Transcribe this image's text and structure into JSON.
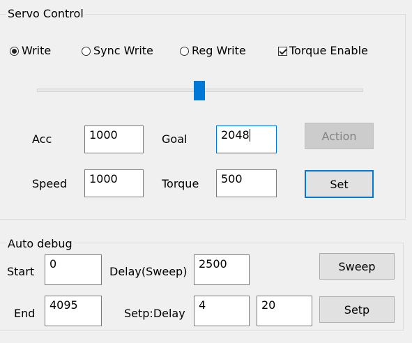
{
  "servo": {
    "title": "Servo Control",
    "modes": [
      {
        "label": "Write",
        "checked": true
      },
      {
        "label": "Sync Write",
        "checked": false
      },
      {
        "label": "Reg Write",
        "checked": false
      }
    ],
    "torque_enable": {
      "label": "Torque Enable",
      "checked": true
    },
    "slider": {
      "value": 0.5
    },
    "acc": {
      "label": "Acc",
      "value": "1000"
    },
    "speed": {
      "label": "Speed",
      "value": "1000"
    },
    "goal": {
      "label": "Goal",
      "value": "2048"
    },
    "torque": {
      "label": "Torque",
      "value": "500"
    },
    "action_label": "Action",
    "set_label": "Set"
  },
  "auto": {
    "title": "Auto debug",
    "start": {
      "label": "Start",
      "value": "0"
    },
    "end": {
      "label": "End",
      "value": "4095"
    },
    "delay_sweep": {
      "label": "Delay(Sweep)",
      "value": "2500"
    },
    "setp_delay": {
      "label": "Setp:Delay",
      "step": "4",
      "delay": "20"
    },
    "sweep_label": "Sweep",
    "setp_label": "Setp"
  },
  "colors": {
    "accent": "#0078d7",
    "window_bg": "#f0f0f0"
  }
}
